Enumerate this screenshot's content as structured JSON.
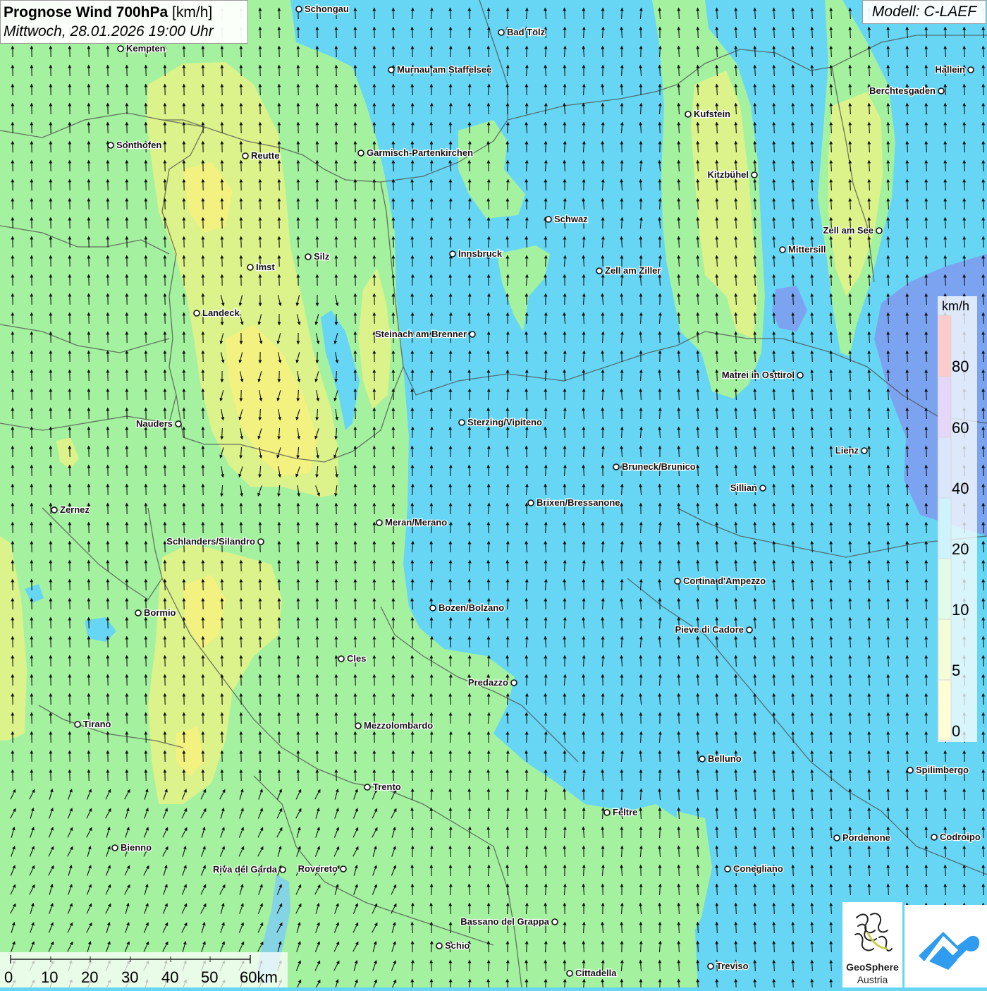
{
  "header": {
    "title": "Prognose Wind 700hPa",
    "unit": "[km/h]",
    "datetime": "Mittwoch, 28.01.2026 19:00 Uhr",
    "model": "Modell: C-LAEF"
  },
  "legend": {
    "unit": "km/h",
    "labels": [
      "80",
      "60",
      "40",
      "20",
      "10",
      "5",
      "0"
    ],
    "colors": [
      "#f43535",
      "#9b5ce6",
      "#6e9cf2",
      "#3ed0f2",
      "#86ee9a",
      "#d5f565",
      "#fff55e"
    ]
  },
  "scale_bar": {
    "labels": [
      "0",
      "10",
      "20",
      "30",
      "40",
      "50",
      "60km"
    ]
  },
  "logo": {
    "line1": "GeoSphere",
    "line2": "Austria"
  },
  "colors": {
    "wind_20_40": "#66d6f4",
    "wind_10_20": "#a4f1a0",
    "wind_5_10": "#dcf28a",
    "wind_0_5": "#f3f281",
    "wind_40_60": "#7ba3f0",
    "logo_blue": "#2f9cf0"
  },
  "cities": [
    {
      "name": "Schongau"
    },
    {
      "name": "Bad Tölz"
    },
    {
      "name": "Kempten"
    },
    {
      "name": "Murnau am Staffelsee"
    },
    {
      "name": "Hallein"
    },
    {
      "name": "Berchtesgaden"
    },
    {
      "name": "Kufstein"
    },
    {
      "name": "Sonthofen"
    },
    {
      "name": "Reutte"
    },
    {
      "name": "Garmisch-Partenkirchen"
    },
    {
      "name": "Kitzbühel"
    },
    {
      "name": "Schwaz"
    },
    {
      "name": "Zell am See"
    },
    {
      "name": "Mittersill"
    },
    {
      "name": "Innsbruck"
    },
    {
      "name": "Silz"
    },
    {
      "name": "Imst"
    },
    {
      "name": "Zell am Ziller"
    },
    {
      "name": "Landeck"
    },
    {
      "name": "Steinach am Brenner"
    },
    {
      "name": "Matrei in Osttirol"
    },
    {
      "name": "Nauders"
    },
    {
      "name": "Sterzing/Vipiteno"
    },
    {
      "name": "Lienz"
    },
    {
      "name": "Bruneck/Brunico"
    },
    {
      "name": "Sillian"
    },
    {
      "name": "Brixen/Bressanone"
    },
    {
      "name": "Zernez"
    },
    {
      "name": "Meran/Merano"
    },
    {
      "name": "Schlanders/Silandro"
    },
    {
      "name": "Cortina d'Ampezzo"
    },
    {
      "name": "Bozen/Bolzano"
    },
    {
      "name": "Bormio"
    },
    {
      "name": "Pieve di Cadore"
    },
    {
      "name": "Cles"
    },
    {
      "name": "Predazzo"
    },
    {
      "name": "Tirano"
    },
    {
      "name": "Mezzolombardo"
    },
    {
      "name": "Belluno"
    },
    {
      "name": "Spilimbergo"
    },
    {
      "name": "Trento"
    },
    {
      "name": "Feltre"
    },
    {
      "name": "Pordenone"
    },
    {
      "name": "Codroipo"
    },
    {
      "name": "Bienno"
    },
    {
      "name": "Riva del Garda"
    },
    {
      "name": "Rovereto"
    },
    {
      "name": "Conegliano"
    },
    {
      "name": "Bassano del Grappa"
    },
    {
      "name": "Schio"
    },
    {
      "name": "Treviso"
    },
    {
      "name": "Cittadella"
    }
  ]
}
